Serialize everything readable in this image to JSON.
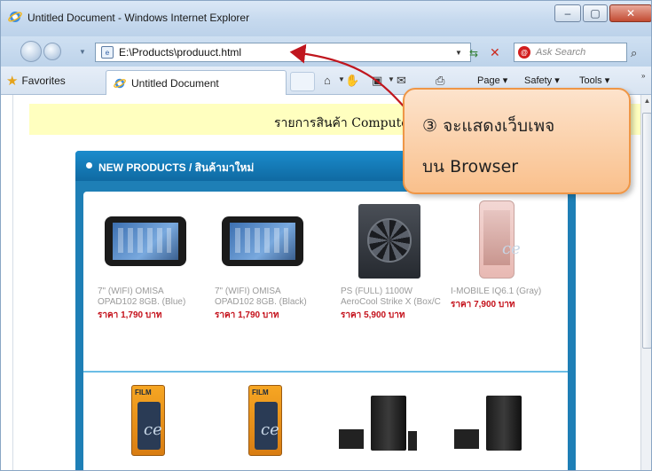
{
  "window": {
    "title": "Untitled Document - Windows Internet Explorer",
    "min_glyph": "–",
    "max_glyph": "▢",
    "close_glyph": "✕"
  },
  "address": {
    "url": "E:\\Products\\produuct.html",
    "search_placeholder": "Ask Search"
  },
  "tabs": {
    "favorites_label": "Favorites",
    "active_tab_label": "Untitled Document"
  },
  "command_bar": {
    "page_label": "Page ▾",
    "safety_label": "Safety ▾",
    "tools_label": "Tools ▾"
  },
  "page": {
    "heading": "รายการสินค้า Computer",
    "panel_title": "NEW PRODUCTS / สินค้ามาใหม่",
    "products_row1": [
      {
        "name": "7\" (WIFI) OMISA OPAD102 8GB. (Blue)",
        "price": "ราคา 1,790 บาท",
        "image": "tablet"
      },
      {
        "name": "7\" (WIFI) OMISA OPAD102 8GB. (Black)",
        "price": "ราคา 1,790 บาท",
        "image": "tablet"
      },
      {
        "name": "PS (FULL) 1100W AeroCool Strike X (Box/C",
        "price": "ราคา 5,900 บาท",
        "image": "power-supply"
      },
      {
        "name": "I-MOBILE IQ6.1 (Gray)",
        "price": "ราคา 7,900 บาท",
        "image": "smartphone"
      }
    ],
    "products_row2_images": [
      "screen-film",
      "screen-film",
      "desktop-pc",
      "desktop-pc"
    ]
  },
  "callout": {
    "line1": "③ จะแสดงเว็บเพจ",
    "line2": "บน Browser"
  },
  "colors": {
    "panel_blue": "#1e7fb6",
    "heading_yellow": "#ffffbf",
    "price_red": "#c4101a",
    "callout_fill": "#f9c08c",
    "arrow_red": "#c0161e"
  }
}
